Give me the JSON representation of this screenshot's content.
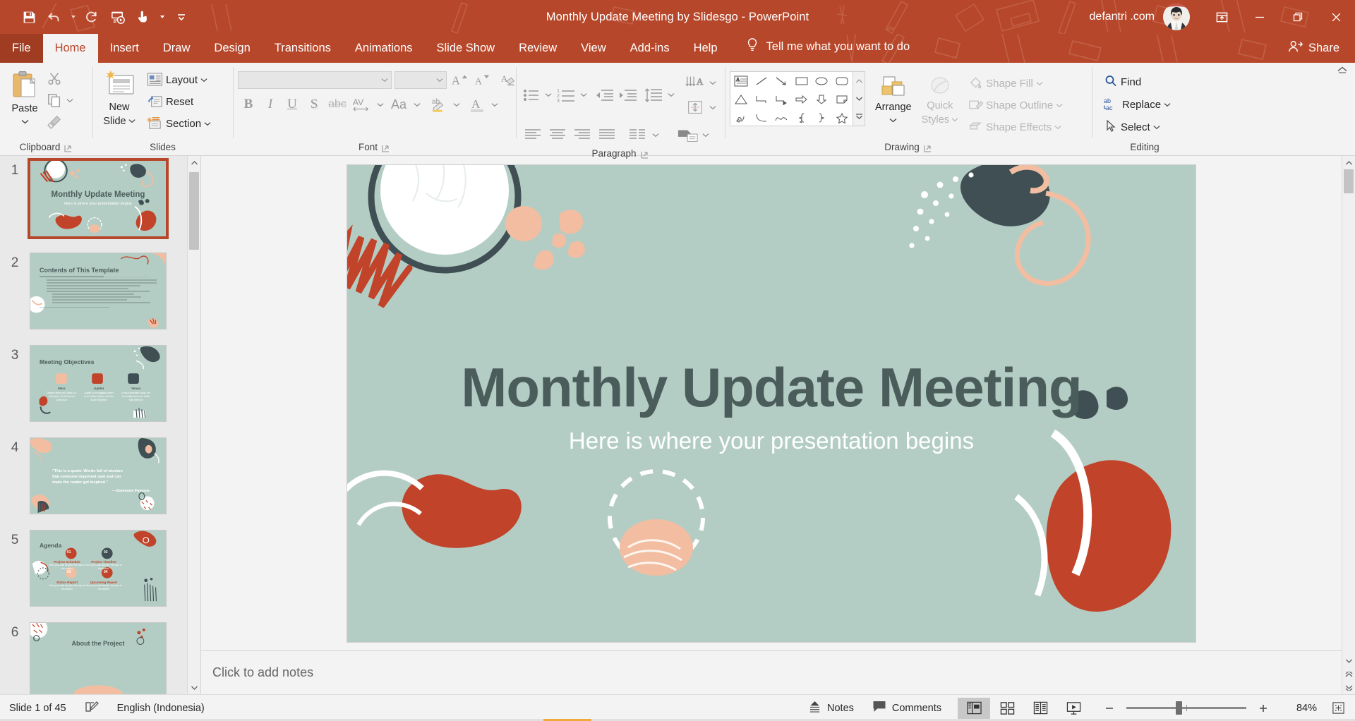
{
  "window": {
    "title": "Monthly Update Meeting by Slidesgo  -  PowerPoint",
    "account_name": "defantri .com",
    "avatar_name": "user-avatar",
    "ribbon_display_options": "Ribbon Display Options",
    "minimize": "Minimize",
    "restore": "Restore Down",
    "close": "Close"
  },
  "quick_access": {
    "items": [
      {
        "name": "save-button",
        "label": "Save",
        "icon": "save-icon"
      },
      {
        "name": "undo-button",
        "label": "Undo",
        "icon": "undo-icon"
      },
      {
        "name": "redo-button",
        "label": "Redo",
        "icon": "redo-icon"
      },
      {
        "name": "start-from-beginning-button",
        "label": "Start From Beginning",
        "icon": "slideshow-icon"
      },
      {
        "name": "touch-mouse-mode-button",
        "label": "Touch/Mouse Mode",
        "icon": "touch-icon"
      },
      {
        "name": "customize-qat-button",
        "label": "Customize Quick Access Toolbar",
        "icon": "chevron-down-icon"
      }
    ]
  },
  "tabs": [
    {
      "label": "File",
      "name": "tab-file"
    },
    {
      "label": "Home",
      "name": "tab-home"
    },
    {
      "label": "Insert",
      "name": "tab-insert"
    },
    {
      "label": "Draw",
      "name": "tab-draw"
    },
    {
      "label": "Design",
      "name": "tab-design"
    },
    {
      "label": "Transitions",
      "name": "tab-transitions"
    },
    {
      "label": "Animations",
      "name": "tab-animations"
    },
    {
      "label": "Slide Show",
      "name": "tab-slide-show"
    },
    {
      "label": "Review",
      "name": "tab-review"
    },
    {
      "label": "View",
      "name": "tab-view"
    },
    {
      "label": "Add-ins",
      "name": "tab-add-ins"
    },
    {
      "label": "Help",
      "name": "tab-help"
    }
  ],
  "active_tab": "Home",
  "tell_me": {
    "label": "Tell me what you want to do",
    "icon": "lightbulb-icon"
  },
  "share": {
    "label": "Share",
    "icon": "share-person-icon"
  },
  "ribbon": {
    "clipboard": {
      "label": "Clipboard",
      "paste": "Paste",
      "cut": "Cut",
      "copy": "Copy",
      "format_painter": "Format Painter"
    },
    "slides": {
      "label": "Slides",
      "new_slide": "New\nSlide",
      "new_slide_line1": "New",
      "new_slide_line2": "Slide",
      "layout": "Layout",
      "reset": "Reset",
      "section": "Section"
    },
    "font": {
      "label": "Font",
      "font_name_value": "",
      "font_name_placeholder": "",
      "font_size_value": "",
      "bold": "B",
      "italic": "I",
      "underline": "U",
      "shadow": "S",
      "strikethrough": "abc",
      "character_spacing": "AV",
      "change_case": "Aa",
      "increase_font_size": "Increase Font Size",
      "decrease_font_size": "Decrease Font Size",
      "clear_formatting": "Clear All Formatting",
      "text_highlight": "Text Highlight Color",
      "font_color": "Font Color"
    },
    "paragraph": {
      "label": "Paragraph",
      "bullets": "Bullets",
      "numbering": "Numbering",
      "decrease_indent": "Decrease List Level",
      "increase_indent": "Increase List Level",
      "line_spacing": "Line Spacing",
      "text_direction": "Text Direction",
      "align_text": "Align Text",
      "convert_to_smartart": "Convert to SmartArt",
      "align_left": "Align Left",
      "center": "Center",
      "align_right": "Align Right",
      "justify": "Justify",
      "columns": "Columns"
    },
    "drawing": {
      "label": "Drawing",
      "arrange": "Arrange",
      "quick_styles_line1": "Quick",
      "quick_styles_line2": "Styles",
      "shape_fill": "Shape Fill",
      "shape_outline": "Shape Outline",
      "shape_effects": "Shape Effects",
      "shapes": [
        "text-box-shape",
        "line-shape",
        "arrow-shape",
        "rectangle-shape",
        "oval-shape",
        "rounded-rectangle-shape",
        "triangle-shape",
        "elbow-connector-shape",
        "elbow-arrow-connector-shape",
        "right-arrow-shape",
        "down-arrow-shape",
        "folded-corner-shape",
        "scribble-shape",
        "curve-shape",
        "freeform-shape",
        "left-brace-shape",
        "right-brace-shape",
        "star-shape"
      ]
    },
    "editing": {
      "label": "Editing",
      "find": "Find",
      "replace": "Replace",
      "select": "Select"
    },
    "collapse": "Collapse the Ribbon"
  },
  "thumbnails": [
    {
      "num": "1",
      "title": "Monthly Update Meeting",
      "subtitle": "Here is where your presentation begins",
      "selected": true,
      "layout": "title"
    },
    {
      "num": "2",
      "title": "Contents of This Template",
      "subtitle": "",
      "selected": false,
      "layout": "contents"
    },
    {
      "num": "3",
      "title": "Meeting Objectives",
      "subtitle": "",
      "selected": false,
      "layout": "objectives"
    },
    {
      "num": "4",
      "title": "“This is a quote. Words full of wisdom that someone important said and can make the reader get inspired.”",
      "subtitle": "—Someone Famous",
      "selected": false,
      "layout": "quote"
    },
    {
      "num": "5",
      "title": "Agenda",
      "subtitle": "",
      "selected": false,
      "layout": "agenda"
    },
    {
      "num": "6",
      "title": "About the Project",
      "subtitle": "",
      "selected": false,
      "layout": "about"
    }
  ],
  "thumb_details": {
    "objectives": [
      {
        "name": "Mars",
        "desc": "Despite being red, Mars is a cold place. It's full of iron oxide dust"
      },
      {
        "name": "Jupiter",
        "desc": "Jupiter is the biggest planet in our Solar System and the fourth brightest"
      },
      {
        "name": "Venus",
        "desc": "It has a beautiful name, but it's terribly hot, even hotter than Mercury"
      }
    ],
    "agenda": [
      {
        "num": "01",
        "title": "Project Schedule",
        "desc": "Here you could describe the topic of the section"
      },
      {
        "num": "02",
        "title": "Project Timeline",
        "desc": "Here you could describe the topic of the section"
      },
      {
        "num": "03",
        "title": "Status Report",
        "desc": "Here you could describe the topic of the section"
      },
      {
        "num": "04",
        "title": "Upcoming Report",
        "desc": "Here you could describe the topic of the section"
      }
    ]
  },
  "slide": {
    "title": "Monthly Update Meeting",
    "subtitle": "Here is where your presentation begins",
    "background_color": "#b4cdc4",
    "title_color": "#4b5d5b",
    "accent_red": "#c1432a",
    "accent_peach": "#f2bda0",
    "accent_dark": "#3f4f54"
  },
  "notes": {
    "placeholder": "Click to add notes"
  },
  "status_bar": {
    "slide_counter": "Slide 1 of 45",
    "language": "English (Indonesia)",
    "spellcheck_icon": "spellcheck-icon",
    "notes": "Notes",
    "comments": "Comments",
    "views": [
      {
        "name": "view-normal",
        "label": "Normal",
        "active": true
      },
      {
        "name": "view-slide-sorter",
        "label": "Slide Sorter",
        "active": false
      },
      {
        "name": "view-reading",
        "label": "Reading View",
        "active": false
      },
      {
        "name": "view-slide-show",
        "label": "Slide Show",
        "active": false
      }
    ],
    "zoom_out": "Zoom Out",
    "zoom_in": "Zoom In",
    "zoom_percent": "84%",
    "fit_to_window": "Fit slide to current window"
  }
}
